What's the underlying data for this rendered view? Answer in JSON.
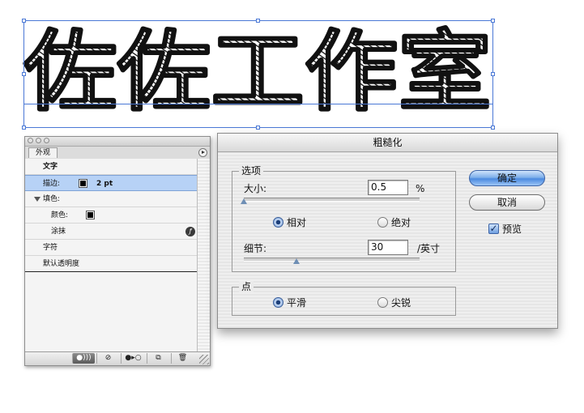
{
  "artwork": {
    "text": "佐佐工作室",
    "selection_color": "#4a78d6"
  },
  "appearance_panel": {
    "tab_label": "外观",
    "rows": {
      "header": "文字",
      "stroke_label": "描边:",
      "stroke_weight": "2 pt",
      "fill_label": "填色:",
      "color_label": "颜色:",
      "scribble_label": "涂抹",
      "characters_label": "字符",
      "default_opacity_label": "默认透明度"
    },
    "fx_icon_glyph": "ƒ",
    "bottom_buttons": [
      "●)))",
      "⊘",
      "●▸○",
      "⧉",
      "🗑"
    ]
  },
  "roughen_dialog": {
    "title": "粗糙化",
    "options_group": {
      "legend": "选项",
      "size_label": "大小:",
      "size_value": "0.5",
      "size_unit": "%",
      "size_level": 0.0,
      "relative_label": "相对",
      "absolute_label": "绝对",
      "relative_selected": true,
      "detail_label": "细节:",
      "detail_value": "30",
      "detail_unit": "/英寸",
      "detail_level": 0.3
    },
    "points_group": {
      "legend": "点",
      "smooth_label": "平滑",
      "corner_label": "尖锐",
      "smooth_selected": true
    },
    "ok_label": "确定",
    "cancel_label": "取消",
    "preview_label": "预览",
    "preview_checked": true
  }
}
